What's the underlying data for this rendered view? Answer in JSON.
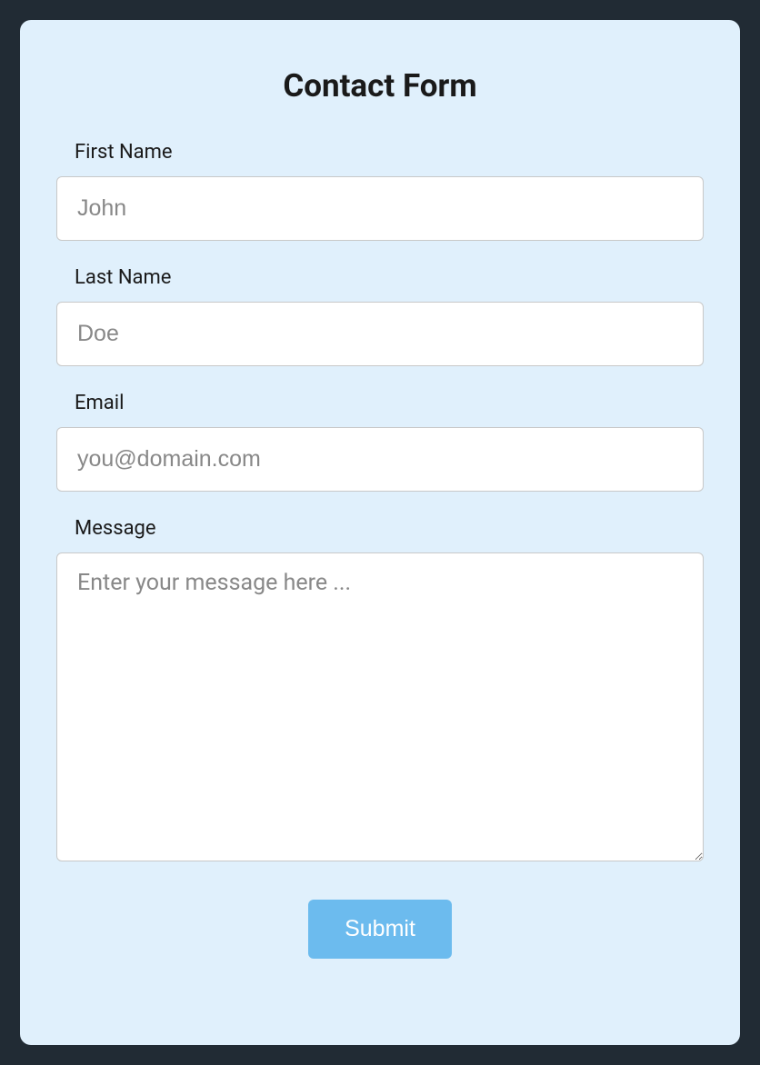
{
  "form": {
    "title": "Contact Form",
    "fields": {
      "firstName": {
        "label": "First Name",
        "placeholder": "John",
        "value": ""
      },
      "lastName": {
        "label": "Last Name",
        "placeholder": "Doe",
        "value": ""
      },
      "email": {
        "label": "Email",
        "placeholder": "you@domain.com",
        "value": ""
      },
      "message": {
        "label": "Message",
        "placeholder": "Enter your message here ...",
        "value": ""
      }
    },
    "submitLabel": "Submit"
  }
}
